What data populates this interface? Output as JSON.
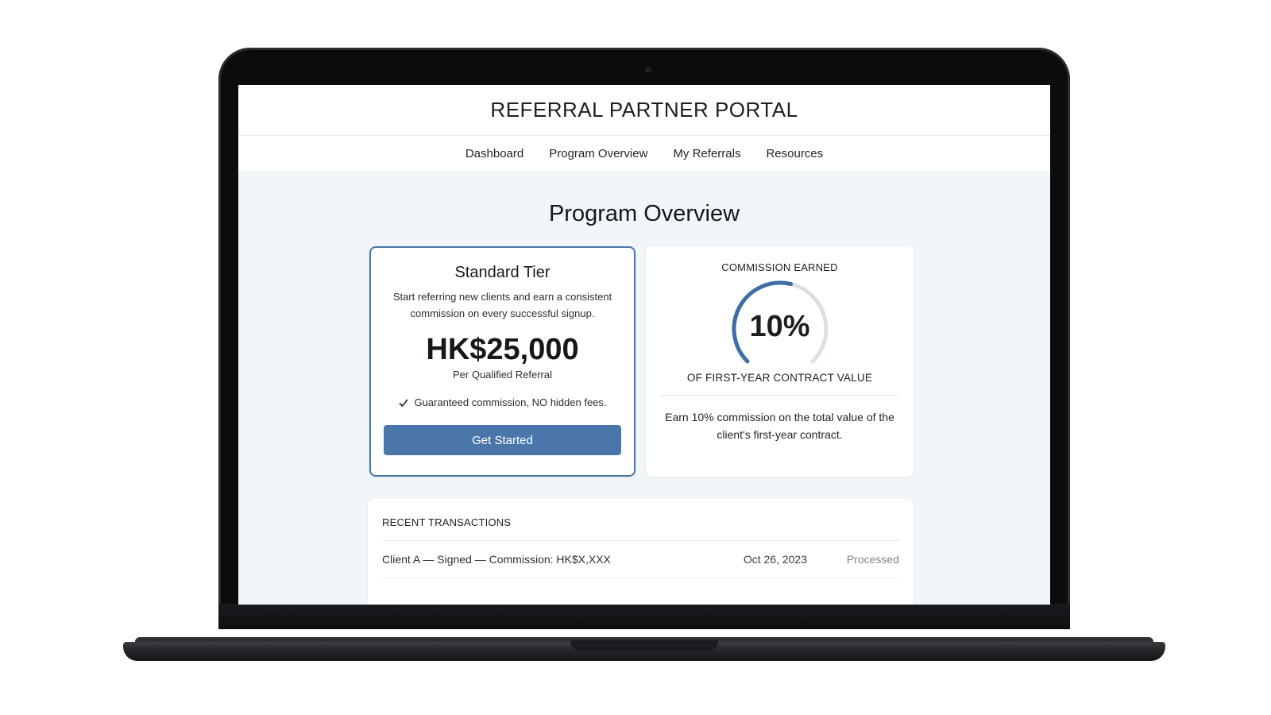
{
  "portal": {
    "title": "REFERRAL PARTNER PORTAL"
  },
  "nav": {
    "items": [
      {
        "label": "Dashboard"
      },
      {
        "label": "Program Overview"
      },
      {
        "label": "My Referrals"
      },
      {
        "label": "Resources"
      }
    ]
  },
  "page": {
    "title": "Program Overview"
  },
  "tier_card": {
    "name": "Standard Tier",
    "description": "Start referring new clients and earn a consistent commission on every successful signup.",
    "amount": "HK$25,000",
    "amount_caption": "Per Qualified Referral",
    "guarantee": "Guaranteed commission, NO hidden fees.",
    "button_label": "Get Started",
    "accent_color": "#4a76aa"
  },
  "commission_card": {
    "title": "COMMISSION EARNED",
    "percent_label": "10%",
    "gauge_fraction": 0.55,
    "caption": "OF FIRST-YEAR CONTRACT VALUE",
    "description": "Earn 10% commission on the total value of the client's first-year contract."
  },
  "transactions": {
    "title": "RECENT TRANSACTIONS",
    "rows": [
      {
        "description": "Client A — Signed — Commission: HK$X,XXX",
        "date": "Oct 26, 2023",
        "status": "Processed"
      }
    ]
  }
}
